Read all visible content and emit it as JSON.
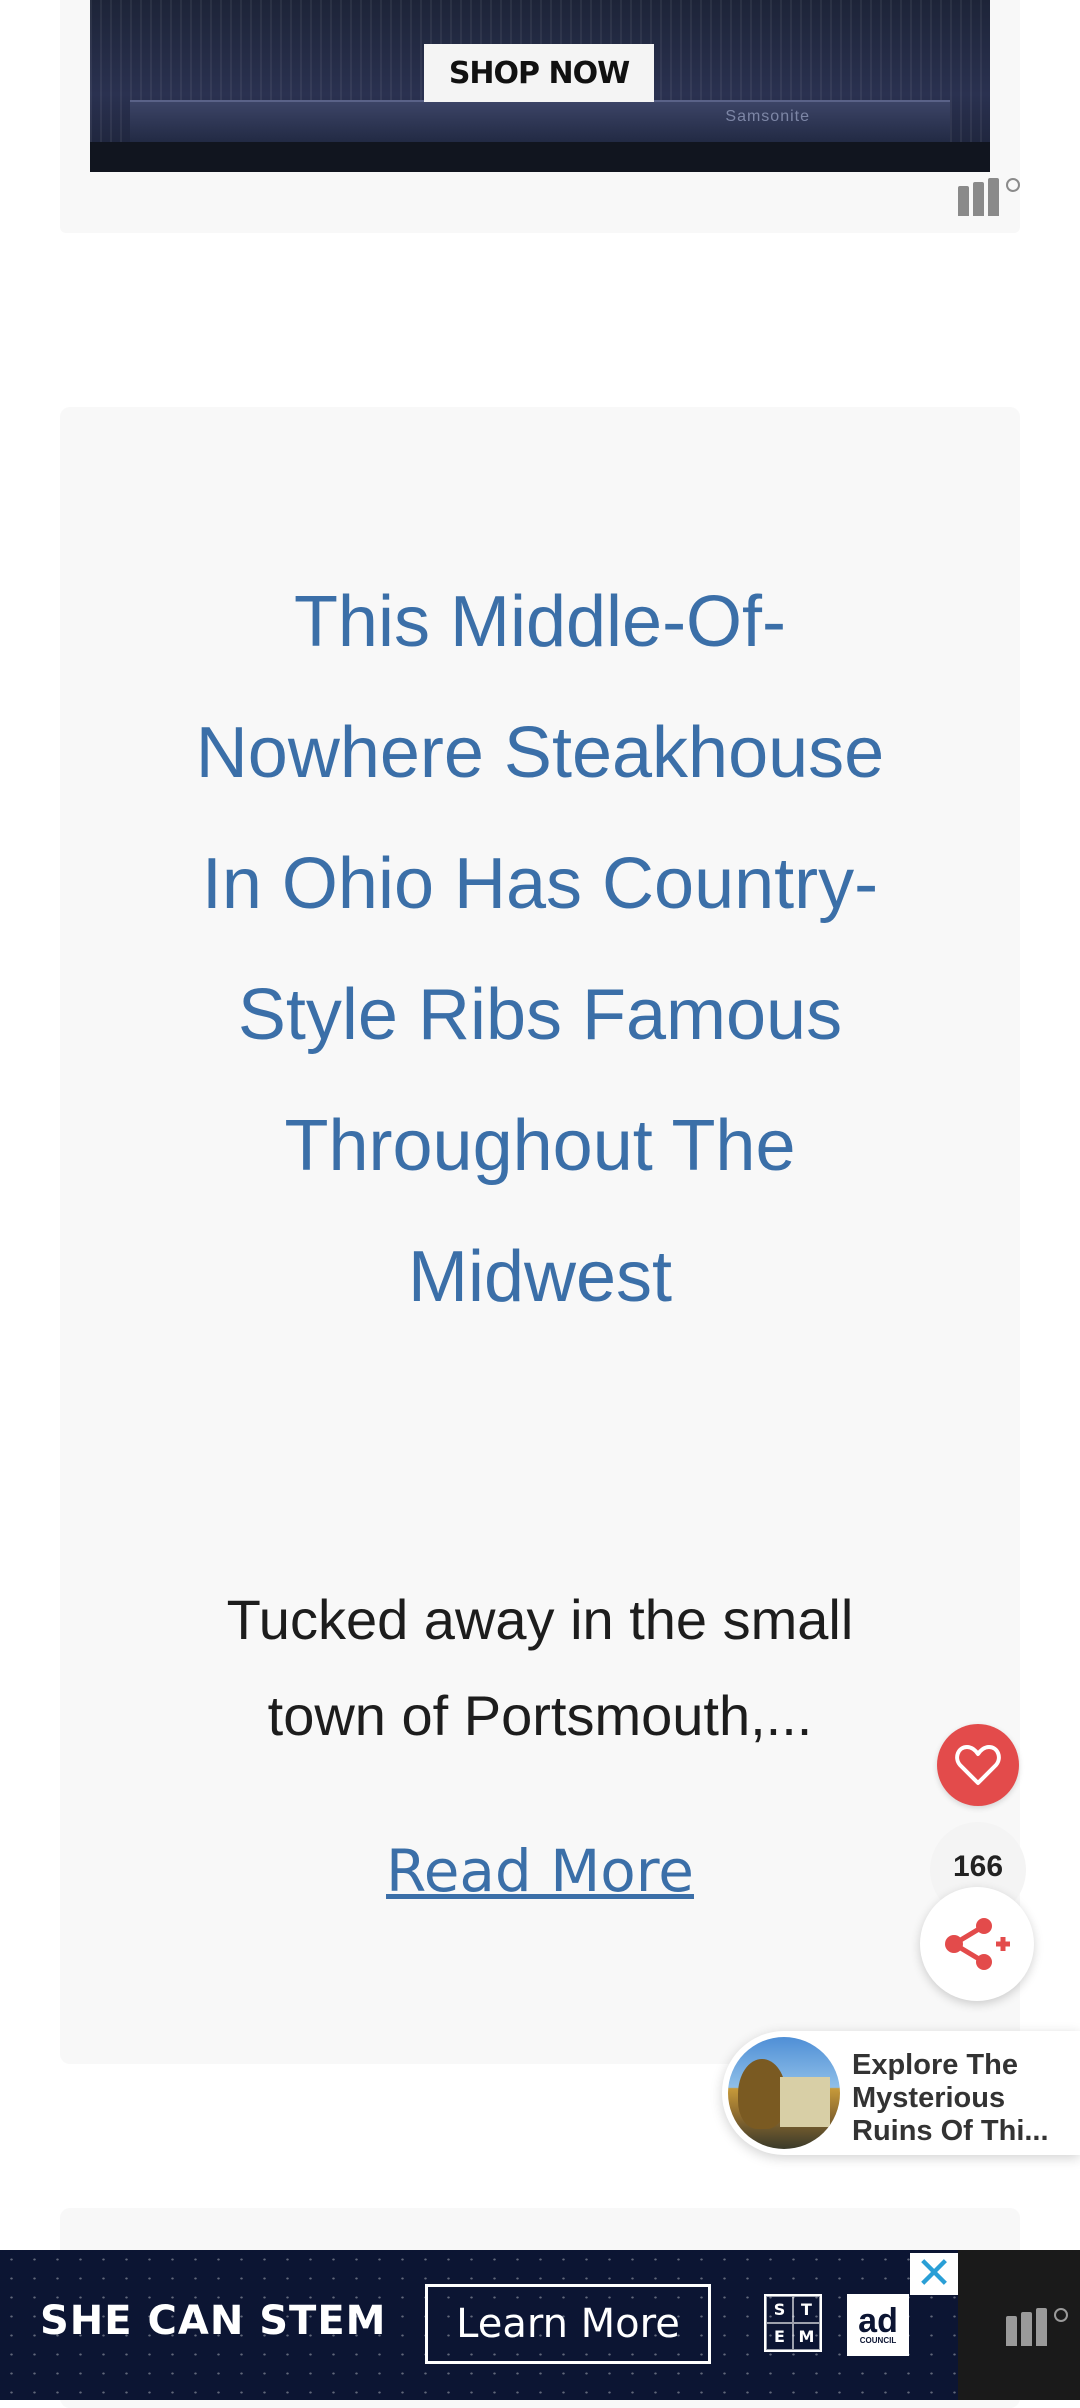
{
  "top_ad": {
    "shop_label": "SHOP NOW",
    "brand_text": "Samsonite"
  },
  "article": {
    "title": "This Middle-Of-Nowhere Steakhouse In Ohio Has Country-Style Ribs Famous Throughout The Midwest",
    "excerpt": "Tucked away in the small town of Portsmouth,...",
    "read_more_label": "Read More"
  },
  "share_widget": {
    "count": "166",
    "heart_icon": "heart-icon",
    "share_icon": "share-icon"
  },
  "recommendation": {
    "title": "Explore The Mysterious Ruins Of Thi..."
  },
  "bottom_ad": {
    "headline": "SHE CAN STEM",
    "cta_label": "Learn More",
    "stem_letters": [
      "S",
      "T",
      "E",
      "M"
    ],
    "council_big": "ad",
    "council_small": "COUNCIL",
    "close_symbol": "✕"
  },
  "colors": {
    "link_blue": "#3b6fa8",
    "heart_red": "#e34b4b",
    "banner_navy": "#0c1533"
  }
}
